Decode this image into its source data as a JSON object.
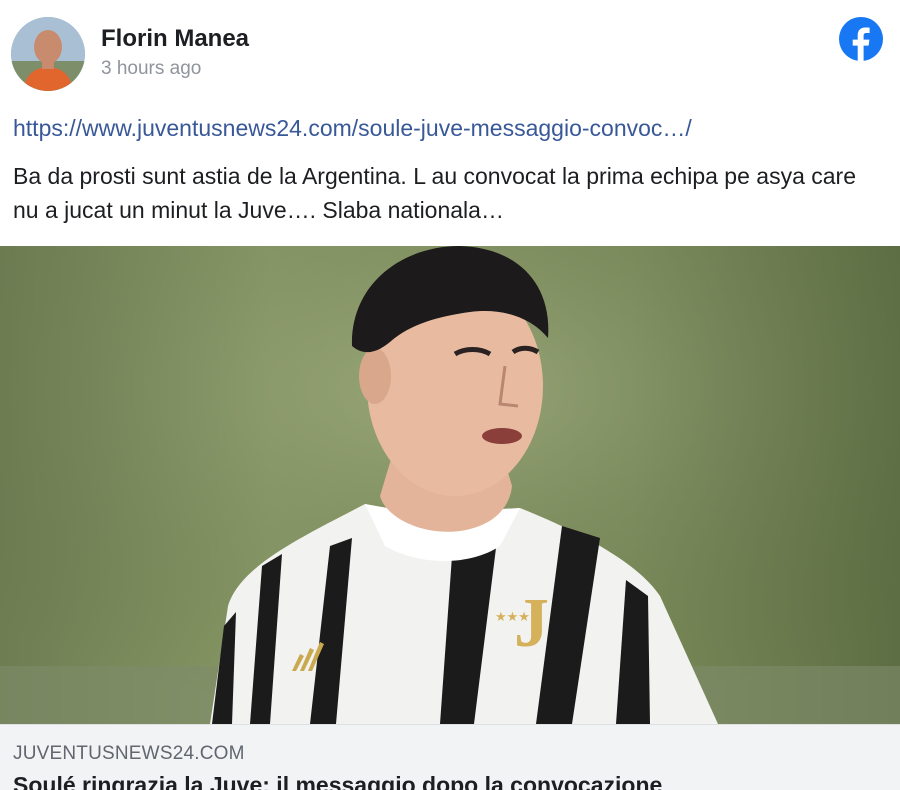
{
  "post": {
    "author": "Florin Manea",
    "timestamp": "3 hours ago",
    "link_url": "https://www.juventusnews24.com/soule-juve-messaggio-convoc…/",
    "text": "Ba da prosti sunt astia de la Argentina. L au convocat la prima echipa pe asya care nu a jucat un minut la Juve…. Slaba nationala…"
  },
  "link_card": {
    "domain": "JUVENTUSNEWS24.COM",
    "title": "Soulé ringrazia la Juve: il messaggio dopo la convocazione"
  },
  "icons": {
    "brand": "facebook-icon",
    "brand_color": "#1877f2"
  }
}
